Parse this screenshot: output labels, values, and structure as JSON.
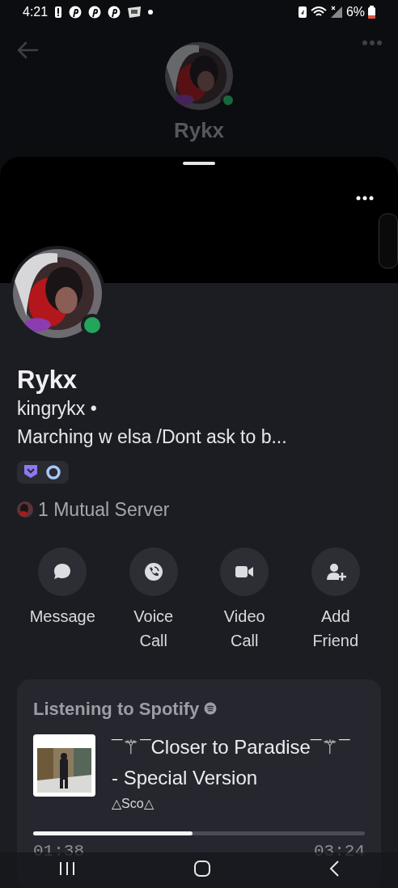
{
  "status_bar": {
    "time": "4:21",
    "battery": "6%"
  },
  "header": {
    "name": "Rykx",
    "online": true
  },
  "profile": {
    "display_name": "Rykx",
    "username": "kingrykx •",
    "status_text": "Marching w elsa /Dont ask to b...",
    "online": true,
    "mutual": "1 Mutual Server"
  },
  "actions": [
    {
      "kind": "message",
      "label": "Message"
    },
    {
      "kind": "voice",
      "label": "Voice\nCall"
    },
    {
      "kind": "video",
      "label": "Video\nCall"
    },
    {
      "kind": "add_friend",
      "label": "Add\nFriend"
    }
  ],
  "activity": {
    "heading": "Listening to Spotify",
    "title": "¯⚚¯Closer to Paradise¯⚚¯ - Special Version",
    "artist": "△Sco△",
    "level": 0.48,
    "elapsed": "01:38",
    "duration": "03:24"
  }
}
